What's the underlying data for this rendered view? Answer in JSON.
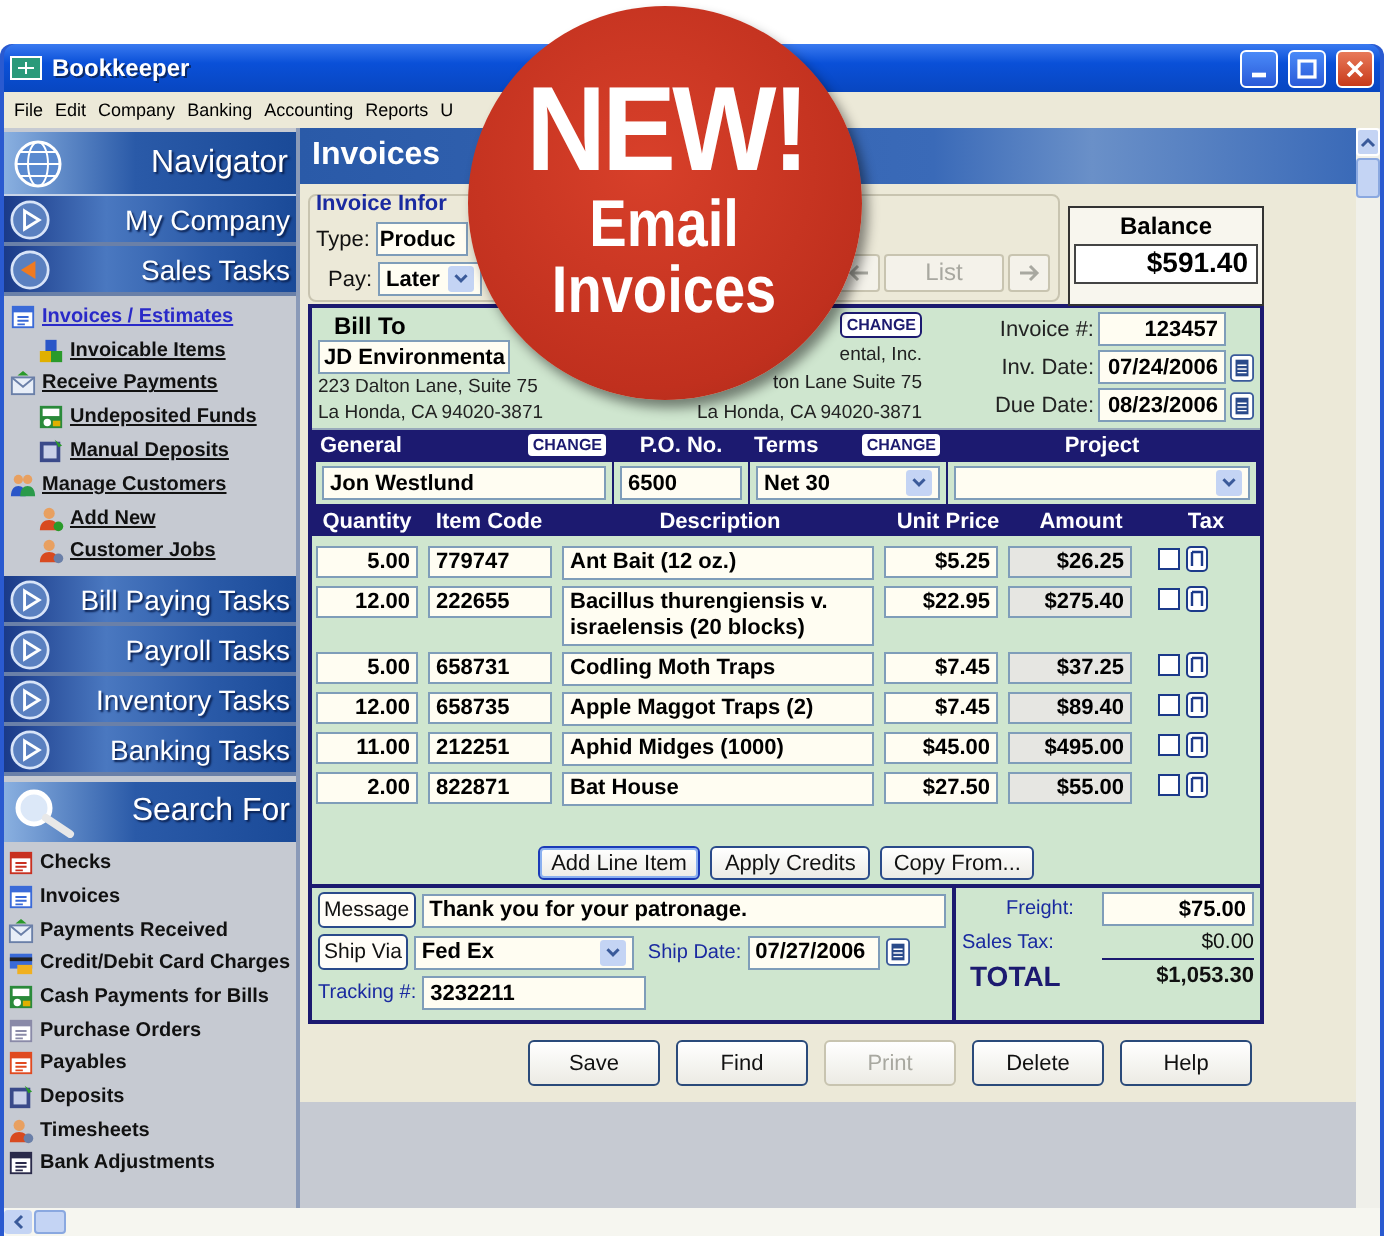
{
  "window": {
    "title": "Bookkeeper"
  },
  "menu": [
    {
      "label": "File"
    },
    {
      "label": "Edit"
    },
    {
      "label": "Company"
    },
    {
      "label": "Banking"
    },
    {
      "label": "Accounting"
    },
    {
      "label": "Reports"
    },
    {
      "label": "U"
    }
  ],
  "promo_badge": {
    "headline": "NEW!",
    "lines": [
      "Email",
      "Invoices"
    ]
  },
  "navigator": {
    "title": "Navigator"
  },
  "task_sections": [
    {
      "label": "My Company",
      "expanded": false
    },
    {
      "label": "Sales Tasks",
      "expanded": true,
      "items": [
        {
          "label": "Invoices / Estimates",
          "selected": true,
          "children": [
            {
              "label": "Invoicable Items",
              "selected": false
            }
          ]
        },
        {
          "label": "Receive Payments",
          "selected": false,
          "children": [
            {
              "label": "Undeposited Funds",
              "selected": false
            },
            {
              "label": "Manual Deposits",
              "selected": false
            }
          ]
        },
        {
          "label": "Manage Customers",
          "selected": false,
          "children": [
            {
              "label": "Add New",
              "selected": false
            },
            {
              "label": "Customer Jobs",
              "selected": false
            }
          ]
        }
      ]
    },
    {
      "label": "Bill Paying Tasks",
      "expanded": false
    },
    {
      "label": "Payroll Tasks",
      "expanded": false
    },
    {
      "label": "Inventory Tasks",
      "expanded": false
    },
    {
      "label": "Banking Tasks",
      "expanded": false
    }
  ],
  "search": {
    "title": "Search For",
    "items": [
      "Checks",
      "Invoices",
      "Payments Received",
      "Credit/Debit Card Charges",
      "Cash Payments for Bills",
      "Purchase Orders",
      "Payables",
      "Deposits",
      "Timesheets",
      "Bank Adjustments"
    ]
  },
  "page_title": "Invoices",
  "invoice_info": {
    "title": "Invoice Infor",
    "type_label": "Type:",
    "type_value": "Produc",
    "pay_label": "Pay:",
    "pay_value": "Later"
  },
  "list_nav": {
    "label": "List",
    "disabled": true
  },
  "balance": {
    "label": "Balance",
    "value": "$591.40"
  },
  "bill_to": {
    "title": "Bill To",
    "name": "JD Environmenta",
    "address": [
      "223 Dalton Lane, Suite 75",
      "La Honda, CA 94020-3871"
    ]
  },
  "ship_to": {
    "change": "CHANGE",
    "address": [
      "ental, Inc.",
      "ton Lane Suite 75",
      "La Honda, CA 94020-3871"
    ]
  },
  "invoice_fields": [
    {
      "label": "Invoice #:",
      "value": "123457",
      "calendar": false
    },
    {
      "label": "Inv. Date:",
      "value": "07/24/2006",
      "calendar": true
    },
    {
      "label": "Due Date:",
      "value": "08/23/2006",
      "calendar": true
    }
  ],
  "header_fields": [
    {
      "label": "General",
      "change": "CHANGE",
      "value": "Jon Westlund",
      "kind": "text"
    },
    {
      "label": "P.O. No.",
      "value": "6500",
      "kind": "text"
    },
    {
      "label": "Terms",
      "change": "CHANGE",
      "value": "Net 30",
      "kind": "dropdown"
    },
    {
      "label": "Project",
      "kind": "dropdown"
    }
  ],
  "columns": [
    "Quantity",
    "Item Code",
    "Description",
    "Unit Price",
    "Amount",
    "Tax"
  ],
  "rows": [
    {
      "quantity": "5.00",
      "code": "779747",
      "description": "Ant Bait (12 oz.)",
      "unit_price": "$5.25",
      "amount": "$26.25",
      "taxed": false
    },
    {
      "quantity": "12.00",
      "code": "222655",
      "description": "Bacillus thurengiensis v. israelensis (20 blocks)",
      "unit_price": "$22.95",
      "amount": "$275.40",
      "taxed": false
    },
    {
      "quantity": "5.00",
      "code": "658731",
      "description": "Codling Moth Traps",
      "unit_price": "$7.45",
      "amount": "$37.25",
      "taxed": false
    },
    {
      "quantity": "12.00",
      "code": "658735",
      "description": "Apple Maggot Traps (2)",
      "unit_price": "$7.45",
      "amount": "$89.40",
      "taxed": false
    },
    {
      "quantity": "11.00",
      "code": "212251",
      "description": "Aphid Midges (1000)",
      "unit_price": "$45.00",
      "amount": "$495.00",
      "taxed": false
    },
    {
      "quantity": "2.00",
      "code": "822871",
      "description": "Bat House",
      "unit_price": "$27.50",
      "amount": "$55.00",
      "taxed": false
    }
  ],
  "line_actions": [
    "Add Line Item",
    "Apply Credits",
    "Copy From..."
  ],
  "footer": {
    "message_button": "Message",
    "message": "Thank you for your patronage.",
    "ship_via_button": "Ship Via",
    "ship_via": "Fed Ex",
    "ship_date_label": "Ship Date:",
    "ship_date": "07/27/2006",
    "tracking_label": "Tracking #:",
    "tracking": "3232211"
  },
  "totals": {
    "freight_label": "Freight:",
    "freight": "$75.00",
    "sales_tax_label": "Sales Tax:",
    "sales_tax": "$0.00",
    "total_label": "TOTAL",
    "total": "$1,053.30"
  },
  "buttons": [
    {
      "label": "Save",
      "disabled": false
    },
    {
      "label": "Find",
      "disabled": false
    },
    {
      "label": "Print",
      "disabled": true
    },
    {
      "label": "Delete",
      "disabled": false
    },
    {
      "label": "Help",
      "disabled": false
    }
  ]
}
